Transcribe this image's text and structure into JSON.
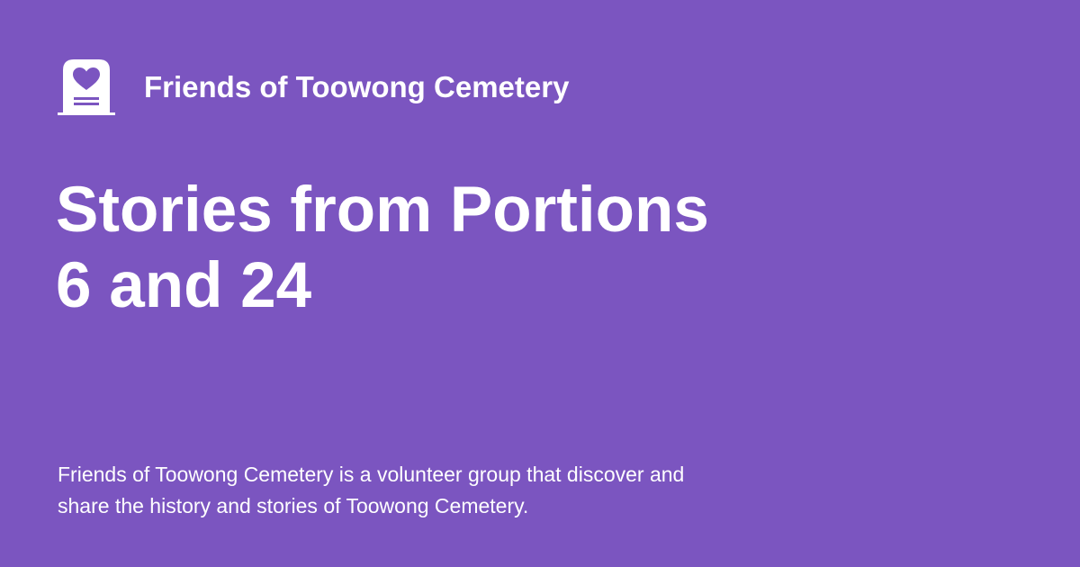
{
  "brand": {
    "name": "Friends of Toowong Cemetery",
    "icon": "headstone-heart-icon"
  },
  "page": {
    "title_lines": [
      "Stories from Portions",
      "6 and 24"
    ]
  },
  "description": {
    "lines": [
      "Friends of Toowong Cemetery is a volunteer group that discover and",
      "share the history and stories of Toowong Cemetery."
    ]
  },
  "colors": {
    "background": "#7b55c0",
    "foreground": "#ffffff"
  }
}
